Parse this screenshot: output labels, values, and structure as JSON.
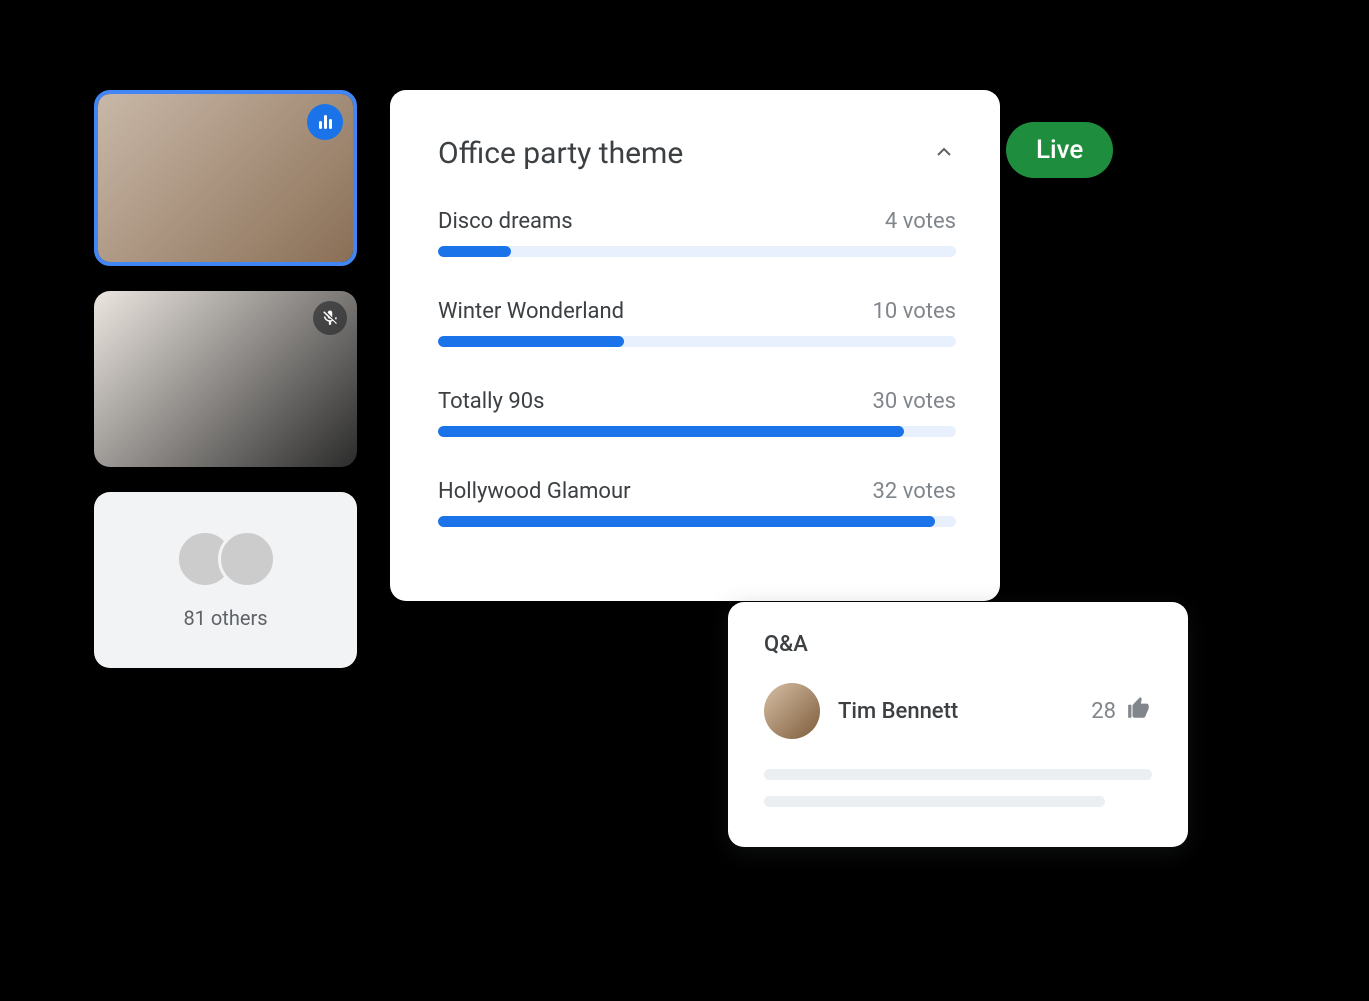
{
  "live_badge": "Live",
  "participants": {
    "others_label": "81 others"
  },
  "poll": {
    "title": "Office party theme",
    "options": [
      {
        "name": "Disco dreams",
        "votes_text": "4 votes",
        "percent": 14
      },
      {
        "name": "Winter Wonderland",
        "votes_text": "10 votes",
        "percent": 36
      },
      {
        "name": "Totally 90s",
        "votes_text": "30 votes",
        "percent": 90
      },
      {
        "name": "Hollywood Glamour",
        "votes_text": "32 votes",
        "percent": 96
      }
    ]
  },
  "qa": {
    "title": "Q&A",
    "item": {
      "name": "Tim Bennett",
      "upvotes": "28"
    }
  }
}
